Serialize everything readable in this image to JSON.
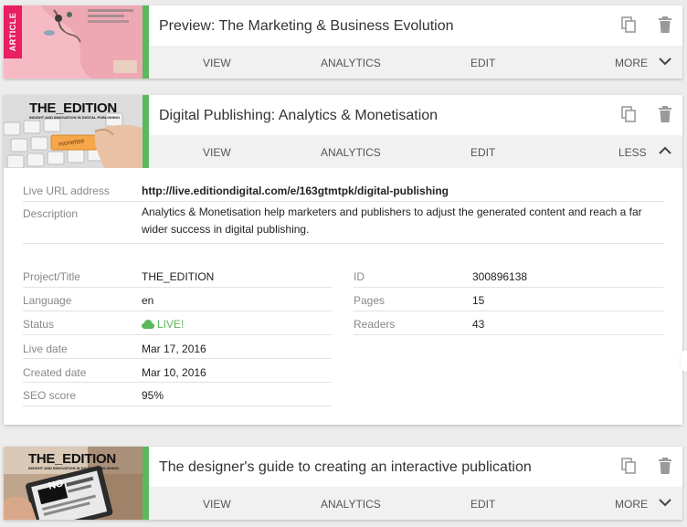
{
  "cards": [
    {
      "title": "Preview: The Marketing & Business Evolution",
      "badge": "ARTICLE",
      "actions": {
        "view": "VIEW",
        "analytics": "ANALYTICS",
        "edit": "EDIT",
        "toggle": "MORE"
      },
      "expanded": false
    },
    {
      "title": "Digital Publishing: Analytics & Monetisation",
      "thumb_logo": "THE_EDITION",
      "thumb_tagline": "INSIGHT AND INNOVATION IN DIGITAL PUBLISHING",
      "thumb_key": "monetise",
      "actions": {
        "view": "VIEW",
        "analytics": "ANALYTICS",
        "edit": "EDIT",
        "toggle": "LESS"
      },
      "expanded": true,
      "details": {
        "live_url_label": "Live URL address",
        "live_url": "http://live.editiondigital.com/e/163gtmtpk/digital-publishing",
        "description_label": "Description",
        "description": "Analytics & Monetisation help marketers and publishers to adjust the generated content and reach a far wider success in digital publishing.",
        "left": [
          {
            "label": "Project/Title",
            "value": "THE_EDITION"
          },
          {
            "label": "Language",
            "value": "en"
          },
          {
            "label": "Status",
            "value": "LIVE!"
          },
          {
            "label": "Live date",
            "value": "Mar 17, 2016"
          },
          {
            "label": "Created date",
            "value": "Mar 10, 2016"
          },
          {
            "label": "SEO score",
            "value": "95%"
          }
        ],
        "right": [
          {
            "label": "ID",
            "value": "300896138"
          },
          {
            "label": "Pages",
            "value": "15"
          },
          {
            "label": "Readers",
            "value": "43"
          }
        ]
      }
    },
    {
      "title": "The designer's guide to creating an interactive publication",
      "thumb_logo": "THE_EDITION",
      "thumb_tagline": "INSIGHT AND INNOVATION IN DIGITAL PUBLISHING",
      "thumb_screen": "NO",
      "actions": {
        "view": "VIEW",
        "analytics": "ANALYTICS",
        "edit": "EDIT",
        "toggle": "MORE"
      },
      "expanded": false
    }
  ],
  "colors": {
    "accent_green": "#5cb85c",
    "badge_pink": "#e91e63"
  },
  "icons": [
    "copy-icon",
    "delete-icon",
    "chevron-down-icon",
    "chevron-up-icon",
    "cloud-icon"
  ]
}
